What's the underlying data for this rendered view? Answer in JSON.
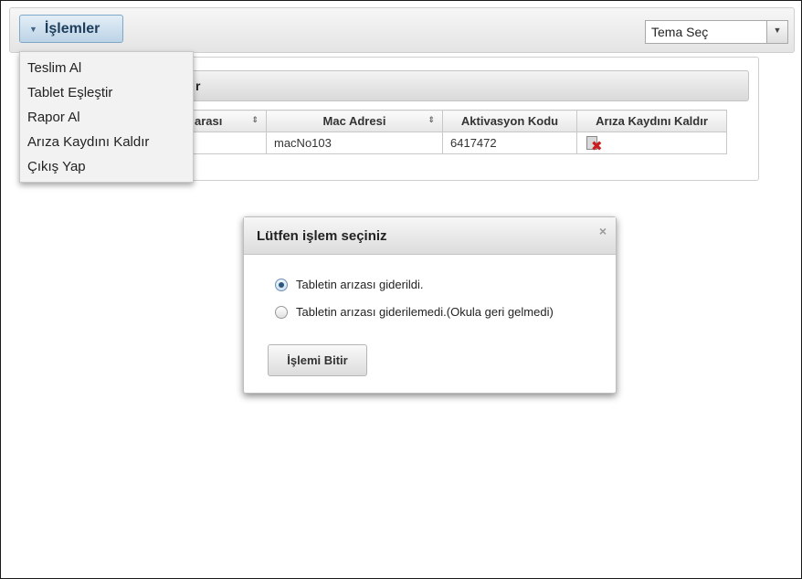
{
  "toolbar": {
    "menu_label": "İşlemler",
    "theme_select_value": "Tema Seç"
  },
  "menu": {
    "items": [
      "Teslim Al",
      "Tablet Eşleştir",
      "Rapor Al",
      "Arıza Kaydını Kaldır",
      "Çıkış Yap"
    ]
  },
  "panel": {
    "header_visible_text": "r",
    "table": {
      "headers": [
        "arası",
        "Mac Adresi",
        "Aktivasyon Kodu",
        "Arıza Kaydını Kaldır"
      ],
      "rows": [
        {
          "col1": "",
          "mac": "macNo103",
          "activation": "6417472",
          "action_icon": "delete-record-icon"
        }
      ]
    }
  },
  "dialog": {
    "title": "Lütfen işlem seçiniz",
    "close_symbol": "×",
    "options": [
      {
        "label": "Tabletin arızası giderildi.",
        "selected": true
      },
      {
        "label": "Tabletin arızası giderilemedi.(Okula geri gelmedi)",
        "selected": false
      }
    ],
    "submit_label": "İşlemi Bitir"
  },
  "icons": {
    "sort": "⇕",
    "caret": "▼"
  }
}
